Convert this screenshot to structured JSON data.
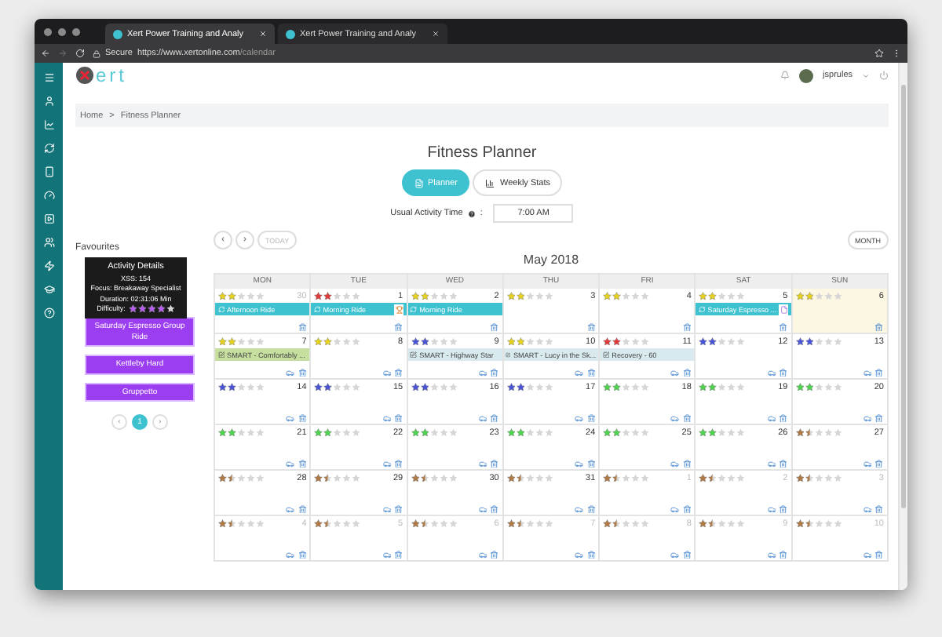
{
  "browser": {
    "tabs": [
      {
        "title": "Xert Power Training and Analy",
        "selected": true
      },
      {
        "title": "Xert Power Training and Analy",
        "selected": false
      }
    ],
    "secure_label": "Secure",
    "url_host": "https://www.xertonline.com",
    "url_path": "/calendar"
  },
  "header": {
    "logo_text": "ert",
    "username": "jsprules"
  },
  "breadcrumb": [
    "Home",
    ">",
    "Fitness Planner"
  ],
  "title": "Fitness Planner",
  "view_toggle": [
    {
      "label": "Planner",
      "selected": true
    },
    {
      "label": "Weekly Stats",
      "selected": false
    }
  ],
  "activity_time": {
    "label": "Usual Activity Time",
    "colon": ":",
    "value": "7:00 AM"
  },
  "nav": {
    "prev": "‹",
    "next": "›",
    "today": "TODAY",
    "view": "MONTH"
  },
  "favourites": {
    "heading": "Favourites",
    "items": [
      "Saturday Espresso Group Ride",
      "Kettleby Hard",
      "Gruppetto"
    ],
    "pages": [
      {
        "label": "1",
        "selected": true
      }
    ],
    "prev": "‹",
    "next": "›"
  },
  "tooltip": {
    "title": "Activity Details",
    "lines": [
      "XSS: 154",
      "Focus: Breakaway Specialist",
      "Duration: 02:31:06 Min"
    ],
    "difficulty_label": "Difficulty:",
    "stars": 4
  },
  "calendar": {
    "month": "May 2018",
    "columns": [
      "MON",
      "TUE",
      "WED",
      "THU",
      "FRI",
      "SAT",
      "SUN"
    ],
    "weeks": [
      {
        "days": [
          {
            "date": "30",
            "other_month": true,
            "today": false,
            "stars": 2,
            "color": "#e6d21e",
            "import_icon": false,
            "events": [
              {
                "kind": "activity",
                "title": "Afternoon Ride",
                "color": "#3ec2cf"
              }
            ]
          },
          {
            "date": "1",
            "other_month": false,
            "today": false,
            "stars": 2,
            "color": "#e03a3a",
            "import_icon": false,
            "events": [
              {
                "kind": "activity",
                "title": "Morning Ride",
                "color": "#3ec2cf",
                "badge": {
                  "kind": "trophy"
                }
              }
            ]
          },
          {
            "date": "2",
            "other_month": false,
            "today": false,
            "stars": 2,
            "color": "#e6d21e",
            "import_icon": false,
            "events": [
              {
                "kind": "activity",
                "title": "Morning Ride",
                "color": "#3ec2cf"
              }
            ]
          },
          {
            "date": "3",
            "other_month": false,
            "today": false,
            "stars": 2,
            "color": "#e6d21e",
            "import_icon": false
          },
          {
            "date": "4",
            "other_month": false,
            "today": false,
            "stars": 2,
            "color": "#e6d21e",
            "import_icon": false
          },
          {
            "date": "5",
            "other_month": false,
            "today": false,
            "stars": 2,
            "color": "#e6d21e",
            "import_icon": false,
            "events": [
              {
                "kind": "activity",
                "title": "Saturday Espresso ...",
                "color": "#3ec2cf",
                "badge": {
                  "kind": "file"
                }
              }
            ]
          },
          {
            "date": "6",
            "other_month": false,
            "today": true,
            "stars": 2,
            "color": "#e6d21e",
            "import_icon": false
          }
        ]
      },
      {
        "days": [
          {
            "date": "7",
            "other_month": false,
            "today": false,
            "stars": 2,
            "color": "#e6d21e",
            "import_icon": true,
            "events": [
              {
                "kind": "workout",
                "title": "SMART - Comfortably ...",
                "color": "#c6df9f"
              }
            ]
          },
          {
            "date": "8",
            "other_month": false,
            "today": false,
            "stars": 2,
            "color": "#e6d21e",
            "import_icon": true
          },
          {
            "date": "9",
            "other_month": false,
            "today": false,
            "stars": 2,
            "color": "#4a55d6",
            "import_icon": true,
            "events": [
              {
                "kind": "workout",
                "title": "SMART - Highway Star",
                "color": "#d8eaee"
              }
            ]
          },
          {
            "date": "10",
            "other_month": false,
            "today": false,
            "stars": 2,
            "color": "#e6d21e",
            "import_icon": true,
            "events": [
              {
                "kind": "workout",
                "title": "SMART - Lucy in the Sk...",
                "color": "#d8eaee"
              }
            ]
          },
          {
            "date": "11",
            "other_month": false,
            "today": false,
            "stars": 2,
            "color": "#e03a3a",
            "import_icon": true,
            "events": [
              {
                "kind": "workout",
                "title": "Recovery - 60",
                "color": "#d8eaee"
              }
            ]
          },
          {
            "date": "12",
            "other_month": false,
            "today": false,
            "stars": 2,
            "color": "#4a55d6",
            "import_icon": true
          },
          {
            "date": "13",
            "other_month": false,
            "today": false,
            "stars": 2,
            "color": "#4a55d6",
            "import_icon": true
          }
        ]
      },
      {
        "days": [
          {
            "date": "14",
            "other_month": false,
            "today": false,
            "stars": 2,
            "color": "#4a55d6",
            "import_icon": true
          },
          {
            "date": "15",
            "other_month": false,
            "today": false,
            "stars": 2,
            "color": "#4a55d6",
            "import_icon": true
          },
          {
            "date": "16",
            "other_month": false,
            "today": false,
            "stars": 2,
            "color": "#4a55d6",
            "import_icon": true
          },
          {
            "date": "17",
            "other_month": false,
            "today": false,
            "stars": 2,
            "color": "#4a55d6",
            "import_icon": true
          },
          {
            "date": "18",
            "other_month": false,
            "today": false,
            "stars": 2,
            "color": "#4fd24f",
            "import_icon": true
          },
          {
            "date": "19",
            "other_month": false,
            "today": false,
            "stars": 2,
            "color": "#4fd24f",
            "import_icon": true
          },
          {
            "date": "20",
            "other_month": false,
            "today": false,
            "stars": 2,
            "color": "#4fd24f",
            "import_icon": true
          }
        ]
      },
      {
        "days": [
          {
            "date": "21",
            "other_month": false,
            "today": false,
            "stars": 2,
            "color": "#4fd24f",
            "import_icon": true
          },
          {
            "date": "22",
            "other_month": false,
            "today": false,
            "stars": 2,
            "color": "#4fd24f",
            "import_icon": true
          },
          {
            "date": "23",
            "other_month": false,
            "today": false,
            "stars": 2,
            "color": "#4fd24f",
            "import_icon": true
          },
          {
            "date": "24",
            "other_month": false,
            "today": false,
            "stars": 2,
            "color": "#4fd24f",
            "import_icon": true
          },
          {
            "date": "25",
            "other_month": false,
            "today": false,
            "stars": 2,
            "color": "#4fd24f",
            "import_icon": true
          },
          {
            "date": "26",
            "other_month": false,
            "today": false,
            "stars": 2,
            "color": "#4fd24f",
            "import_icon": true
          },
          {
            "date": "27",
            "other_month": false,
            "today": false,
            "stars": 1.5,
            "color": "#b07a45",
            "import_icon": true
          }
        ]
      },
      {
        "days": [
          {
            "date": "28",
            "other_month": false,
            "today": false,
            "stars": 1.5,
            "color": "#b07a45",
            "import_icon": true
          },
          {
            "date": "29",
            "other_month": false,
            "today": false,
            "stars": 1.5,
            "color": "#b07a45",
            "import_icon": true
          },
          {
            "date": "30",
            "other_month": false,
            "today": false,
            "stars": 1.5,
            "color": "#b07a45",
            "import_icon": true
          },
          {
            "date": "31",
            "other_month": false,
            "today": false,
            "stars": 1.5,
            "color": "#b07a45",
            "import_icon": true
          },
          {
            "date": "1",
            "other_month": true,
            "today": false,
            "stars": 1.5,
            "color": "#b07a45",
            "import_icon": true
          },
          {
            "date": "2",
            "other_month": true,
            "today": false,
            "stars": 1.5,
            "color": "#b07a45",
            "import_icon": true
          },
          {
            "date": "3",
            "other_month": true,
            "today": false,
            "stars": 1.5,
            "color": "#b07a45",
            "import_icon": true
          }
        ]
      },
      {
        "days": [
          {
            "date": "4",
            "other_month": true,
            "today": false,
            "stars": 1.5,
            "color": "#b07a45",
            "import_icon": true
          },
          {
            "date": "5",
            "other_month": true,
            "today": false,
            "stars": 1.5,
            "color": "#b07a45",
            "import_icon": true
          },
          {
            "date": "6",
            "other_month": true,
            "today": false,
            "stars": 1.5,
            "color": "#b07a45",
            "import_icon": true
          },
          {
            "date": "7",
            "other_month": true,
            "today": false,
            "stars": 1.5,
            "color": "#b07a45",
            "import_icon": true
          },
          {
            "date": "8",
            "other_month": true,
            "today": false,
            "stars": 1.5,
            "color": "#b07a45",
            "import_icon": true
          },
          {
            "date": "9",
            "other_month": true,
            "today": false,
            "stars": 1.5,
            "color": "#b07a45",
            "import_icon": true
          },
          {
            "date": "10",
            "other_month": true,
            "today": false,
            "stars": 1.5,
            "color": "#b07a45",
            "import_icon": true
          }
        ]
      }
    ]
  }
}
